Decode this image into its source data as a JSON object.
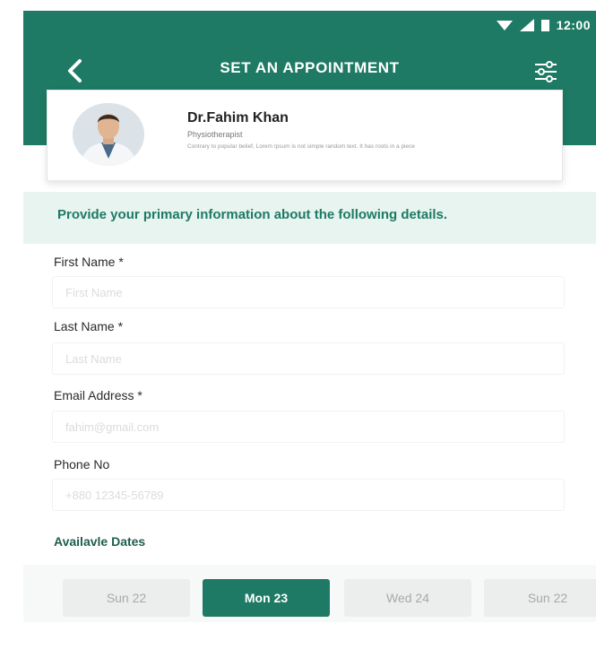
{
  "status_bar": {
    "time": "12:00"
  },
  "header": {
    "title": "SET AN APPOINTMENT"
  },
  "doctor": {
    "name": "Dr.Fahim Khan",
    "role": "Physiotherapist",
    "description": "Contrary to popular belief, Lorem Ipsum is not simple random text. It has roots in a piece"
  },
  "info_banner": {
    "text": "Provide your primary information about the following details."
  },
  "form": {
    "first_name": {
      "label": "First Name *",
      "placeholder": "First Name",
      "value": ""
    },
    "last_name": {
      "label": "Last Name *",
      "placeholder": "Last Name",
      "value": ""
    },
    "email": {
      "label": "Email Address *",
      "placeholder": "fahim@gmail.com",
      "value": ""
    },
    "phone": {
      "label": "Phone No",
      "placeholder": "+880 12345-56789",
      "value": ""
    }
  },
  "available_dates": {
    "label": "Availavle Dates",
    "dates": [
      {
        "label": "Sun 22",
        "selected": false
      },
      {
        "label": "Mon 23",
        "selected": true
      },
      {
        "label": "Wed 24",
        "selected": false
      },
      {
        "label": "Sun 22",
        "selected": false
      }
    ]
  },
  "colors": {
    "primary": "#1e7a64",
    "banner": "#e8f4ef",
    "chip": "#eceeee"
  }
}
